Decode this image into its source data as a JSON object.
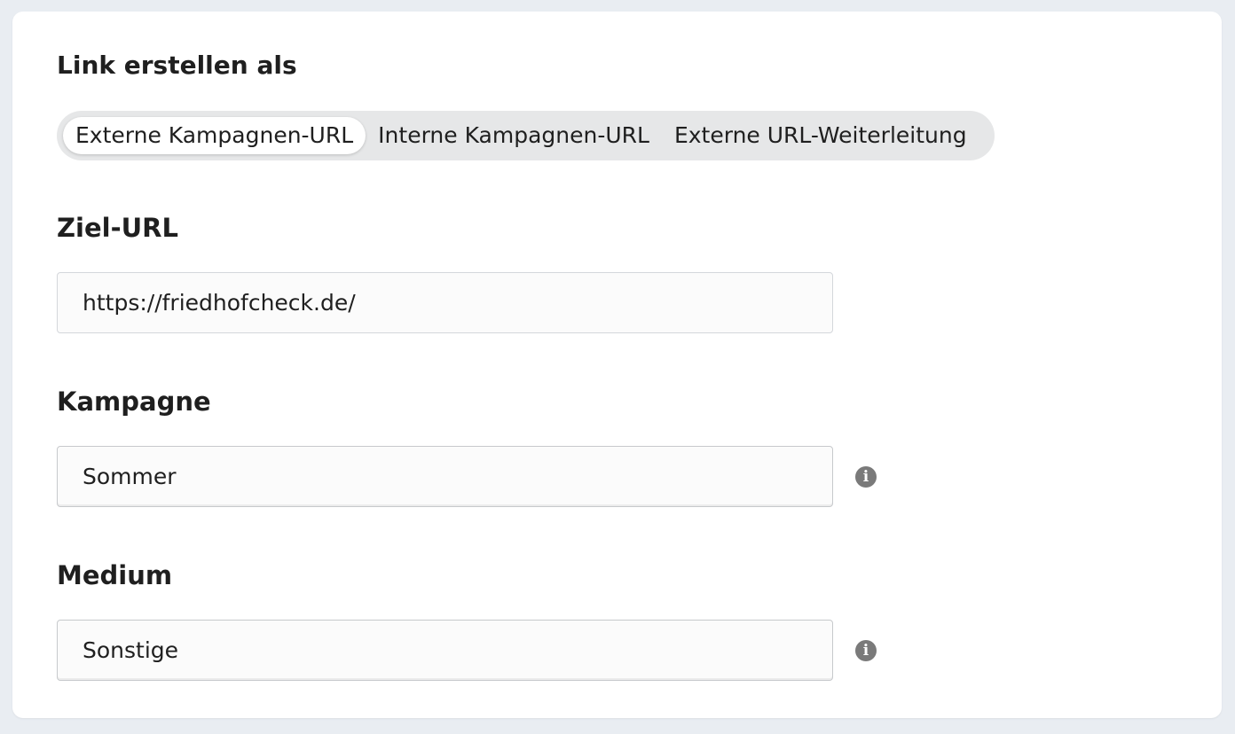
{
  "link_type": {
    "heading": "Link erstellen als",
    "options": [
      {
        "label": "Externe Kampagnen-URL",
        "selected": true
      },
      {
        "label": "Interne Kampagnen-URL",
        "selected": false
      },
      {
        "label": "Externe URL-Weiterleitung",
        "selected": false
      }
    ]
  },
  "target_url": {
    "label": "Ziel-URL",
    "value": "https://friedhofcheck.de/"
  },
  "campaign": {
    "label": "Kampagne",
    "value": "Sommer",
    "info_icon": "info-icon"
  },
  "medium": {
    "label": "Medium",
    "value": "Sonstige",
    "info_icon": "info-icon"
  },
  "colors": {
    "page_background": "#e9edf2",
    "card_background": "#ffffff",
    "segmented_track": "#e6e7e8",
    "info_icon": "#7a7a7a",
    "text": "#1f1f1f"
  }
}
